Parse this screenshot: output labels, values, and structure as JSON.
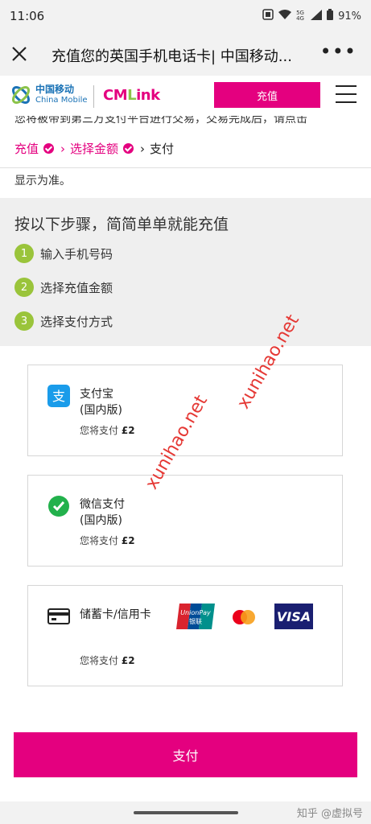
{
  "status": {
    "time": "11:06",
    "battery": "91%",
    "network": "5G 4G"
  },
  "titlebar": {
    "title": "充值您的英国手机电话卡| 中国移动...",
    "more": "•••"
  },
  "header": {
    "logo_cn": "中国移动",
    "logo_en": "China Mobile",
    "cmlink_a": "CM",
    "cmlink_b": "L",
    "cmlink_c": "ink",
    "recharge_label": "充值"
  },
  "cut_text": "您将被带到第三方支付平台进行交易，交易完成后，请点击",
  "breadcrumb": {
    "step1": "充值",
    "step2": "选择金额",
    "step3": "支付"
  },
  "notice": "显示为准。",
  "steps": {
    "heading": "按以下步骤，简简单单就能充值",
    "items": [
      {
        "num": "1",
        "label": "输入手机号码"
      },
      {
        "num": "2",
        "label": "选择充值金额"
      },
      {
        "num": "3",
        "label": "选择支付方式"
      }
    ]
  },
  "payment_methods": [
    {
      "name_line1": "支付宝",
      "name_line2": "(国内版)",
      "amount_prefix": "您将支付",
      "amount": "£2",
      "icon": "alipay-icon"
    },
    {
      "name_line1": "微信支付",
      "name_line2": "(国内版)",
      "amount_prefix": "您将支付",
      "amount": "£2",
      "icon": "wechat-pay-icon"
    },
    {
      "name_line1": "储蓄卡/信用卡",
      "amount_prefix": "您将支付",
      "amount": "£2",
      "icon": "card-icon",
      "logos": {
        "unionpay": "UnionPay",
        "unionpay_cn": "银联",
        "visa": "VISA"
      }
    }
  ],
  "pay_button": "支付",
  "footer_watermark": "知乎 @虚拟号",
  "watermark_text": "xunihao.net",
  "colors": {
    "brand_pink": "#e4007f",
    "step_green": "#9ac43b",
    "cm_blue": "#1b73b6"
  }
}
